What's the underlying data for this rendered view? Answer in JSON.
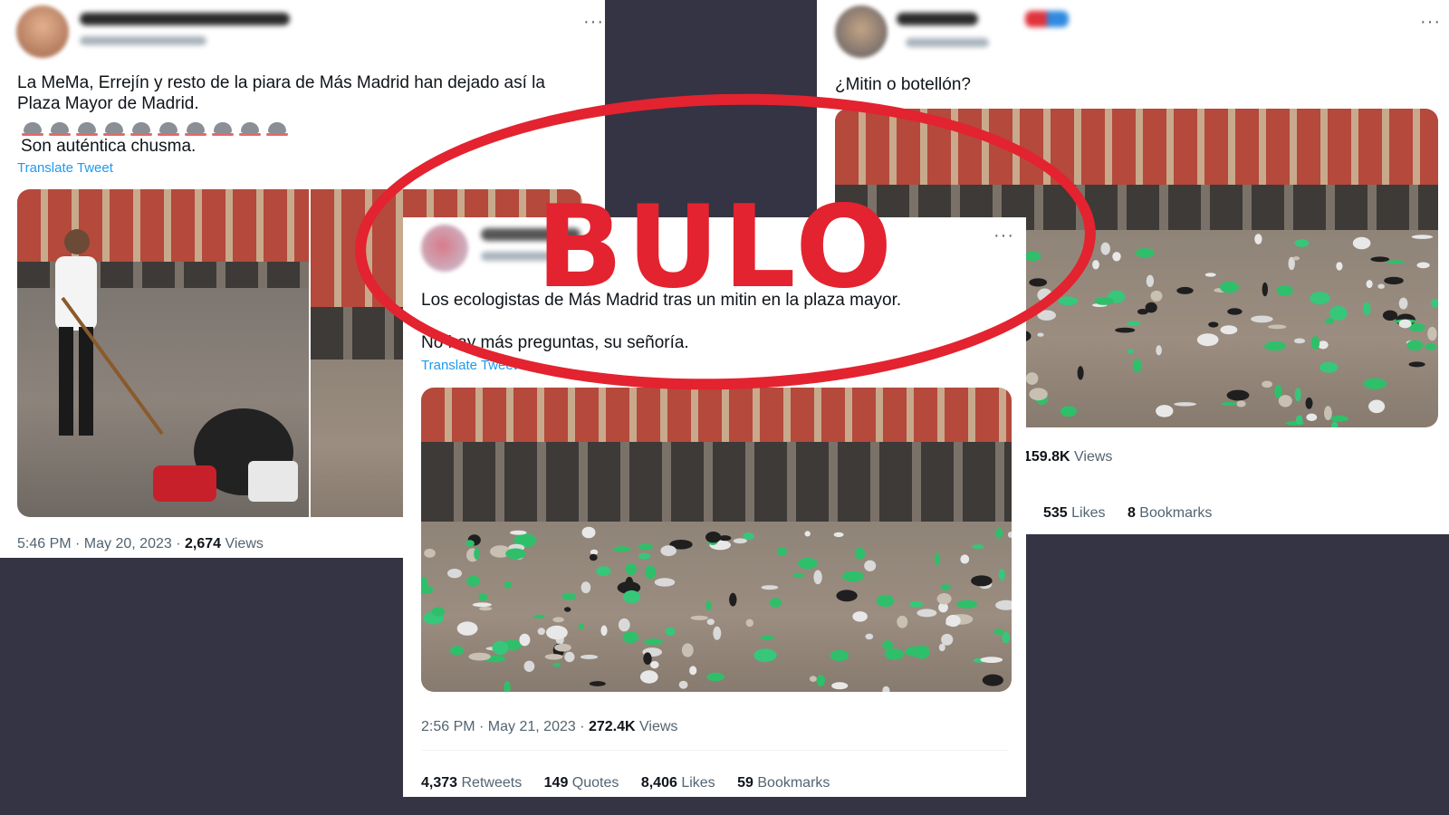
{
  "left_tweet": {
    "text": "La MeMa, Errejín y resto de la piara de Más Madrid han dejado así la Plaza Mayor de Madrid.",
    "text_line2": "Son auténtica chusma.",
    "translate": "Translate Tweet",
    "time": "5:46 PM · May 20, 2023 · ",
    "views_count": "2,674",
    "views_label": " Views",
    "more": "···"
  },
  "right_tweet": {
    "text": "¿Mitin o botellón?",
    "views_count": "159.8K",
    "views_label": " Views",
    "likes_count": "535",
    "likes_label": " Likes",
    "bookmarks_count": "8",
    "bookmarks_label": " Bookmarks",
    "more": "···"
  },
  "center_tweet": {
    "text_line1": "Los ecologistas de Más Madrid tras un mitin en la plaza mayor.",
    "text_line2": "No hay más preguntas, su señoría.",
    "translate": "Translate Tweet",
    "time": "2:56 PM · May 21, 2023 · ",
    "views_count": "272.4K",
    "views_label": " Views",
    "retweets_count": "4,373",
    "retweets_label": " Retweets",
    "quotes_count": "149",
    "quotes_label": " Quotes",
    "likes_count": "8,406",
    "likes_label": " Likes",
    "bookmarks_count": "59",
    "bookmarks_label": " Bookmarks",
    "more": "···"
  },
  "stamp": {
    "label": "BULO",
    "color": "#e3232f"
  },
  "icons": {
    "emoji": "rat-emoji",
    "count": 10
  }
}
